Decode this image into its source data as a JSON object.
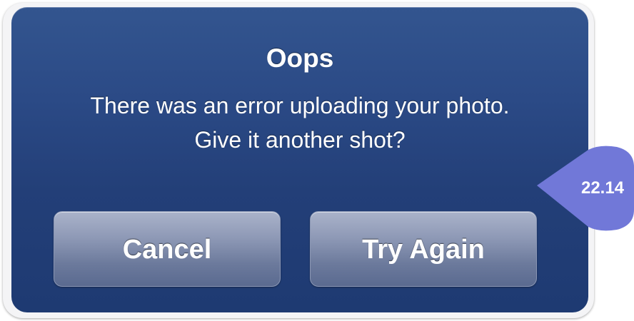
{
  "alert": {
    "title": "Oops",
    "message_line1": "There was an error uploading your photo.",
    "message_line2": "Give it another shot?",
    "buttons": {
      "cancel_label": "Cancel",
      "retry_label": "Try Again"
    }
  },
  "badge": {
    "value": "22.14",
    "color": "#7178d8"
  },
  "colors": {
    "alert_background": "#2b4a86",
    "button_background": "#8e99b6",
    "text": "#ffffff"
  }
}
